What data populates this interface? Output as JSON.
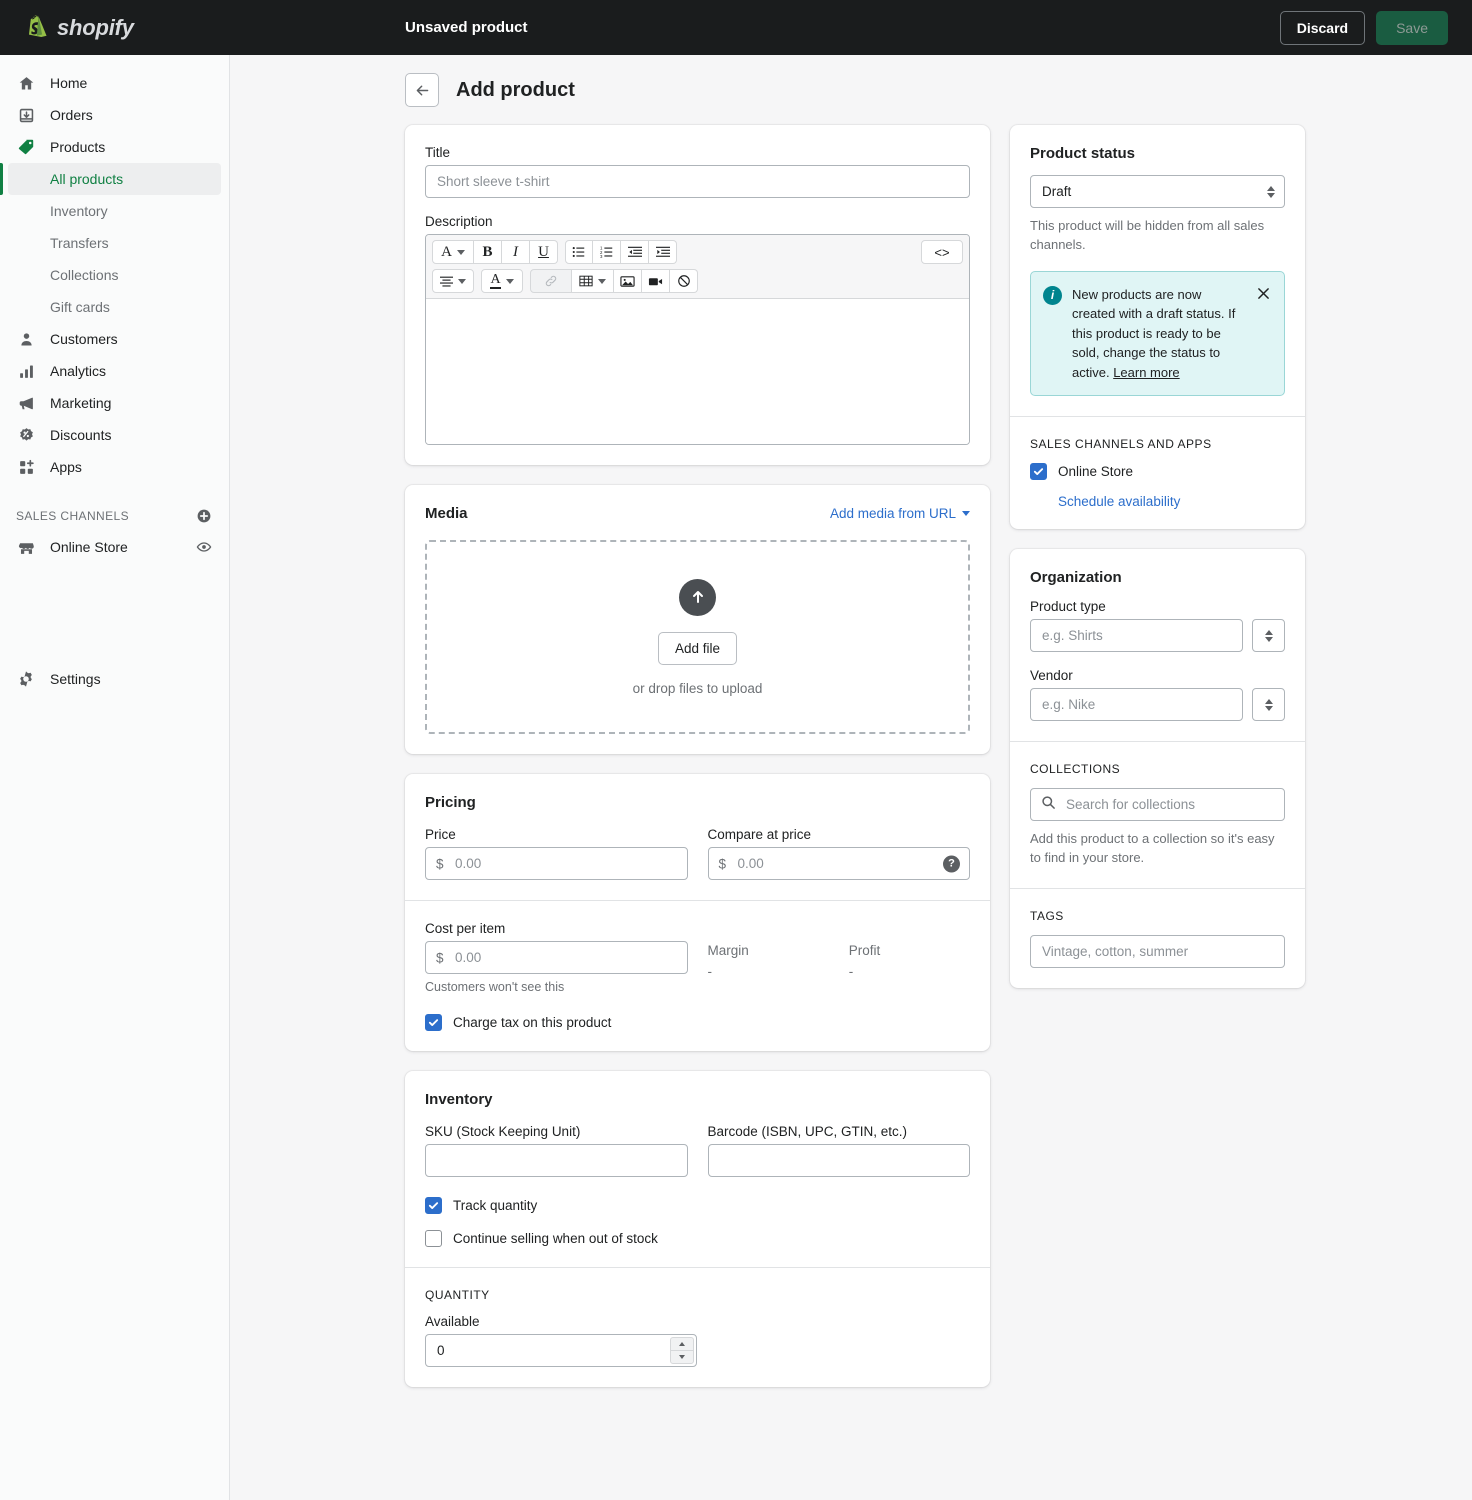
{
  "topbar": {
    "brand": "shopify",
    "title": "Unsaved product",
    "discard_label": "Discard",
    "save_label": "Save"
  },
  "sidebar": {
    "items": [
      {
        "label": "Home",
        "icon": "home-icon"
      },
      {
        "label": "Orders",
        "icon": "orders-inbox-icon"
      },
      {
        "label": "Products",
        "icon": "products-tag-icon"
      }
    ],
    "product_subitems": [
      {
        "label": "All products",
        "active": true
      },
      {
        "label": "Inventory",
        "active": false
      },
      {
        "label": "Transfers",
        "active": false
      },
      {
        "label": "Collections",
        "active": false
      },
      {
        "label": "Gift cards",
        "active": false
      }
    ],
    "items2": [
      {
        "label": "Customers",
        "icon": "customers-person-icon"
      },
      {
        "label": "Analytics",
        "icon": "analytics-bars-icon"
      },
      {
        "label": "Marketing",
        "icon": "marketing-megaphone-icon"
      },
      {
        "label": "Discounts",
        "icon": "discounts-percent-icon"
      },
      {
        "label": "Apps",
        "icon": "apps-grid-plus-icon"
      }
    ],
    "sales_channels_heading": "SALES CHANNELS",
    "online_store": "Online Store",
    "settings": "Settings"
  },
  "page": {
    "title": "Add product",
    "back_label": "Back"
  },
  "title_card": {
    "title_label": "Title",
    "title_placeholder": "Short sleeve t-shirt",
    "title_value": "",
    "description_label": "Description"
  },
  "editor_toolbar": {
    "row1": [
      {
        "name": "format-text-icon",
        "glyph": "A",
        "caret": true
      },
      {
        "name": "bold-icon",
        "glyph": "B"
      },
      {
        "name": "italic-icon",
        "glyph": "I"
      },
      {
        "name": "underline-icon",
        "glyph": "U"
      },
      {
        "name": "bulleted-list-icon",
        "glyph": "☰"
      },
      {
        "name": "numbered-list-icon",
        "glyph": "☰"
      },
      {
        "name": "outdent-icon",
        "glyph": "⇤"
      },
      {
        "name": "indent-icon",
        "glyph": "⇥"
      }
    ],
    "code_view": "<>",
    "row2": [
      {
        "name": "align-text-icon",
        "caret": true
      },
      {
        "name": "text-color-icon",
        "glyph": "A",
        "caret": true
      },
      {
        "name": "insert-link-icon",
        "disabled": true
      },
      {
        "name": "insert-table-icon",
        "caret": true
      },
      {
        "name": "insert-image-icon"
      },
      {
        "name": "insert-video-icon"
      },
      {
        "name": "clear-formatting-icon"
      }
    ]
  },
  "media": {
    "heading": "Media",
    "add_from_url": "Add media from URL",
    "add_file_label": "Add file",
    "drop_hint": "or drop files to upload"
  },
  "pricing": {
    "heading": "Pricing",
    "price_label": "Price",
    "price_currency": "$",
    "price_placeholder": "0.00",
    "compare_label": "Compare at price",
    "compare_currency": "$",
    "compare_placeholder": "0.00",
    "cost_label": "Cost per item",
    "cost_currency": "$",
    "cost_placeholder": "0.00",
    "cost_note": "Customers won't see this",
    "margin_label": "Margin",
    "margin_value": "-",
    "profit_label": "Profit",
    "profit_value": "-",
    "charge_tax_label": "Charge tax on this product",
    "charge_tax_checked": true
  },
  "inventory": {
    "heading": "Inventory",
    "sku_label": "SKU (Stock Keeping Unit)",
    "sku_value": "",
    "barcode_label": "Barcode (ISBN, UPC, GTIN, etc.)",
    "barcode_value": "",
    "track_quantity_label": "Track quantity",
    "track_quantity_checked": true,
    "continue_selling_label": "Continue selling when out of stock",
    "continue_selling_checked": false,
    "quantity_heading": "QUANTITY",
    "available_label": "Available",
    "available_value": "0"
  },
  "product_status": {
    "heading": "Product status",
    "selected": "Draft",
    "note": "This product will be hidden from all sales channels.",
    "banner_text_before": "New products are now created with a draft status. If this product is ready to be sold, change the status to active. ",
    "banner_link": "Learn more",
    "channels_heading": "SALES CHANNELS AND APPS",
    "online_store_label": "Online Store",
    "online_store_checked": true,
    "schedule_link": "Schedule availability"
  },
  "organization": {
    "heading": "Organization",
    "product_type_label": "Product type",
    "product_type_placeholder": "e.g. Shirts",
    "vendor_label": "Vendor",
    "vendor_placeholder": "e.g. Nike",
    "collections_heading": "COLLECTIONS",
    "collections_placeholder": "Search for collections",
    "collections_note": "Add this product to a collection so it's easy to find in your store.",
    "tags_heading": "TAGS",
    "tags_placeholder": "Vintage, cotton, summer"
  },
  "colors": {
    "brand_green": "#108043",
    "accent_blue": "#2c6ecb",
    "banner_teal": "#00848e",
    "topbar_dark": "#1a1c1d"
  }
}
